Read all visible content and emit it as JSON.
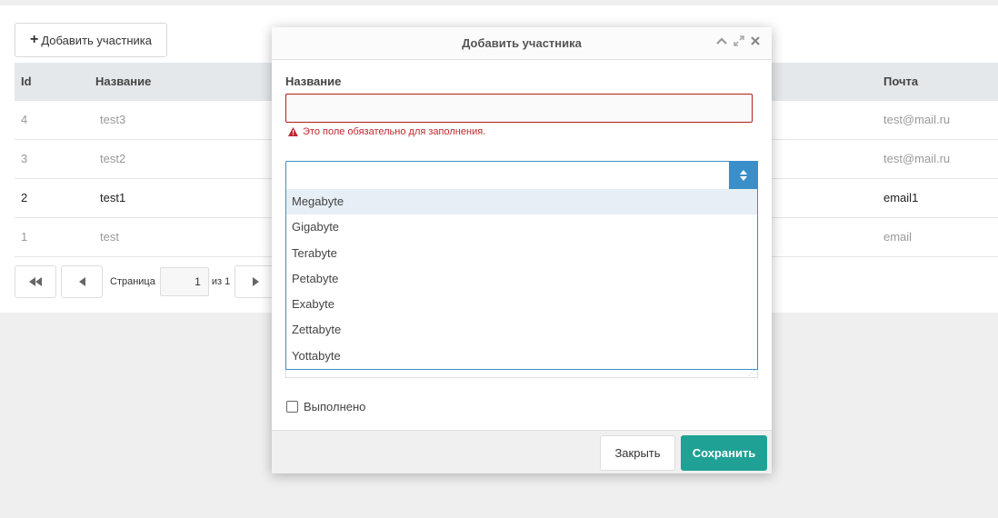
{
  "toolbar": {
    "add_label": "Добавить участника"
  },
  "table": {
    "headers": {
      "id": "Id",
      "name": "Название",
      "email": "Почта"
    },
    "rows": [
      {
        "id": "4",
        "name": "test3",
        "email": "test@mail.ru"
      },
      {
        "id": "3",
        "name": "test2",
        "email": "test@mail.ru"
      },
      {
        "id": "2",
        "name": "test1",
        "email": "email1"
      },
      {
        "id": "1",
        "name": "test",
        "email": "email"
      }
    ]
  },
  "pager": {
    "page_label": "Страница",
    "page_value": "1",
    "of_label": "из 1"
  },
  "modal": {
    "title": "Добавить участника",
    "name_label": "Название",
    "name_value": "",
    "error_text": "Это поле обязательно для заполнения.",
    "select_value": "",
    "options": [
      "Megabyte",
      "Gigabyte",
      "Terabyte",
      "Petabyte",
      "Exabyte",
      "Zettabyte",
      "Yottabyte"
    ],
    "highlighted_option": "Megabyte",
    "done_label": "Выполнено",
    "done_checked": false,
    "close_label": "Закрыть",
    "save_label": "Сохранить"
  },
  "colors": {
    "accent": "#3a8fc9",
    "save": "#1fa195",
    "error": "#c0272d"
  }
}
